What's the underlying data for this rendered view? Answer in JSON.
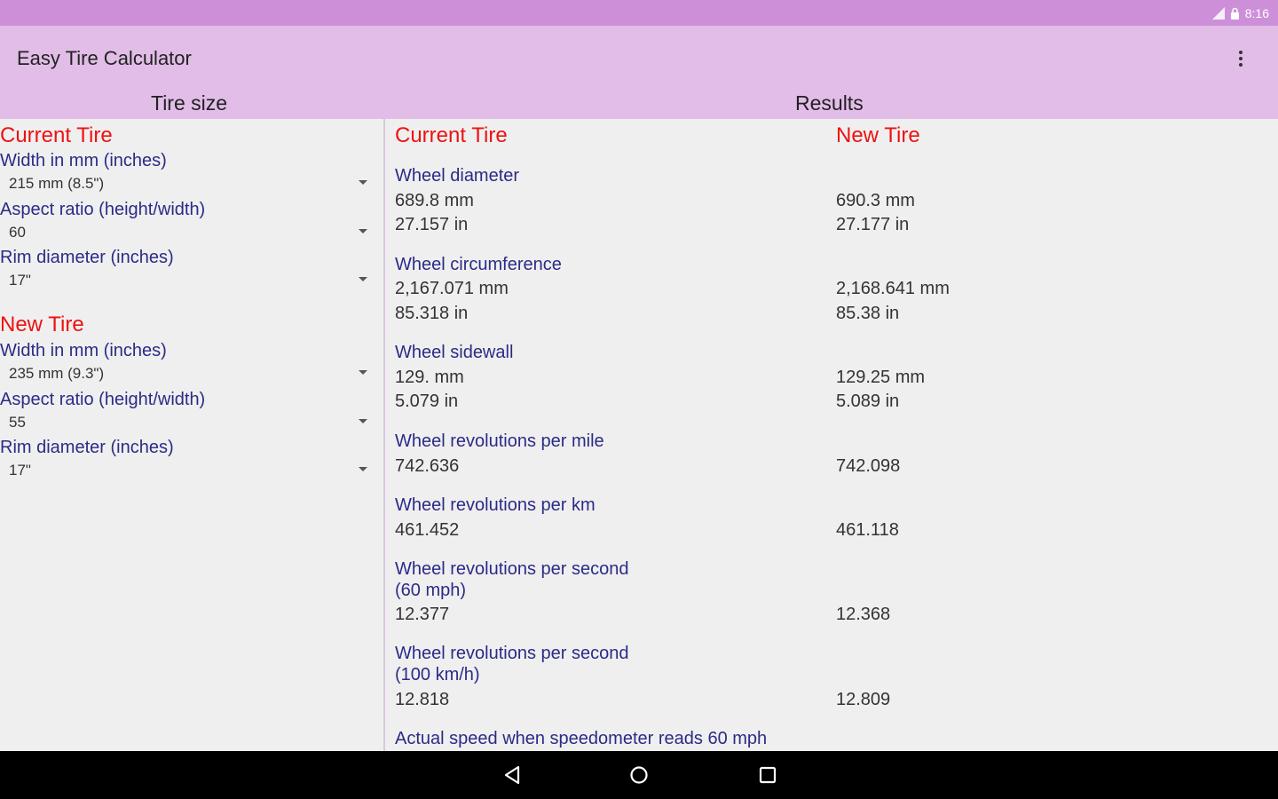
{
  "status_bar": {
    "time": "8:16",
    "icons": [
      "signal-icon",
      "lock-icon"
    ]
  },
  "app_bar": {
    "title": "Easy Tire Calculator",
    "menu_icon": "overflow-icon"
  },
  "tabs": {
    "tire_size": "Tire size",
    "results": "Results"
  },
  "tire_size": {
    "current": {
      "heading": "Current Tire",
      "width_label": "Width in mm (inches)",
      "width_value": "215 mm (8.5\")",
      "aspect_label": "Aspect ratio (height/width)",
      "aspect_value": "60",
      "rim_label": "Rim diameter (inches)",
      "rim_value": "17\""
    },
    "new": {
      "heading": "New Tire",
      "width_label": "Width in mm (inches)",
      "width_value": "235 mm (9.3\")",
      "aspect_label": "Aspect ratio (height/width)",
      "aspect_value": "55",
      "rim_label": "Rim diameter (inches)",
      "rim_value": "17\""
    }
  },
  "results": {
    "current_heading": "Current Tire",
    "new_heading": "New Tire",
    "rows": [
      {
        "label": "Wheel diameter",
        "current": [
          "689.8 mm",
          "27.157 in"
        ],
        "new": [
          "690.3 mm",
          "27.177 in"
        ]
      },
      {
        "label": "Wheel circumference",
        "current": [
          "2,167.071 mm",
          "85.318 in"
        ],
        "new": [
          "2,168.641 mm",
          "85.38 in"
        ]
      },
      {
        "label": "Wheel sidewall",
        "current": [
          "129. mm",
          "5.079 in"
        ],
        "new": [
          "129.25 mm",
          "5.089 in"
        ]
      },
      {
        "label": "Wheel revolutions per mile",
        "current": [
          "742.636"
        ],
        "new": [
          "742.098"
        ]
      },
      {
        "label": "Wheel revolutions per km",
        "current": [
          "461.452"
        ],
        "new": [
          "461.118"
        ]
      },
      {
        "label": "Wheel revolutions per second",
        "label2": "(60 mph)",
        "current": [
          "12.377"
        ],
        "new": [
          "12.368"
        ]
      },
      {
        "label": "Wheel revolutions per second",
        "label2": "(100 km/h)",
        "current": [
          "12.818"
        ],
        "new": [
          "12.809"
        ]
      },
      {
        "label": "Actual speed when speedometer reads 60 mph"
      }
    ]
  },
  "nav_bar": {
    "icons": [
      "back-icon",
      "home-icon",
      "recents-icon"
    ]
  }
}
